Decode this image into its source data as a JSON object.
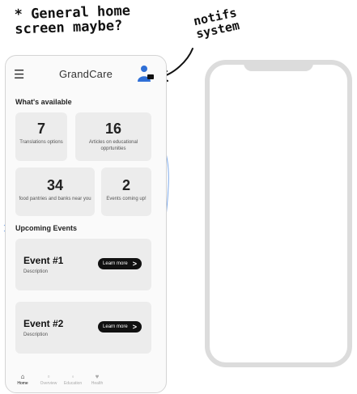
{
  "annotations": {
    "note_home": "* General home\nscreen maybe?",
    "note_notifs": "notifs\nsystem"
  },
  "app": {
    "menu_icon": "hamburger-menu-icon",
    "title": "GrandCare",
    "profile_icon": "person-notification-icon"
  },
  "available": {
    "title": "What's available",
    "cards": [
      {
        "number": "7",
        "label": "Translations options"
      },
      {
        "number": "16",
        "label": "Articles on educational opprtunities"
      },
      {
        "number": "34",
        "label": "food pantries and banks near you"
      },
      {
        "number": "2",
        "label": "Events coming up!"
      }
    ]
  },
  "events": {
    "title": "Upcoming Events",
    "items": [
      {
        "title": "Event #1",
        "description": "Description",
        "button": "Learn more"
      },
      {
        "title": "Event #2",
        "description": "Description",
        "button": "Learn more"
      }
    ]
  },
  "tabs": [
    {
      "label": "Home",
      "icon": "home-icon",
      "active": true
    },
    {
      "label": "Overview",
      "icon": "overview-icon",
      "active": false
    },
    {
      "label": "Education",
      "icon": "education-icon",
      "active": false
    },
    {
      "label": "Health",
      "icon": "heart-icon",
      "active": false
    }
  ],
  "colors": {
    "accent_blue": "#2f6fd6",
    "connector_blue": "#7aa7e8",
    "card_bg": "#ececec",
    "button_bg": "#111111"
  }
}
